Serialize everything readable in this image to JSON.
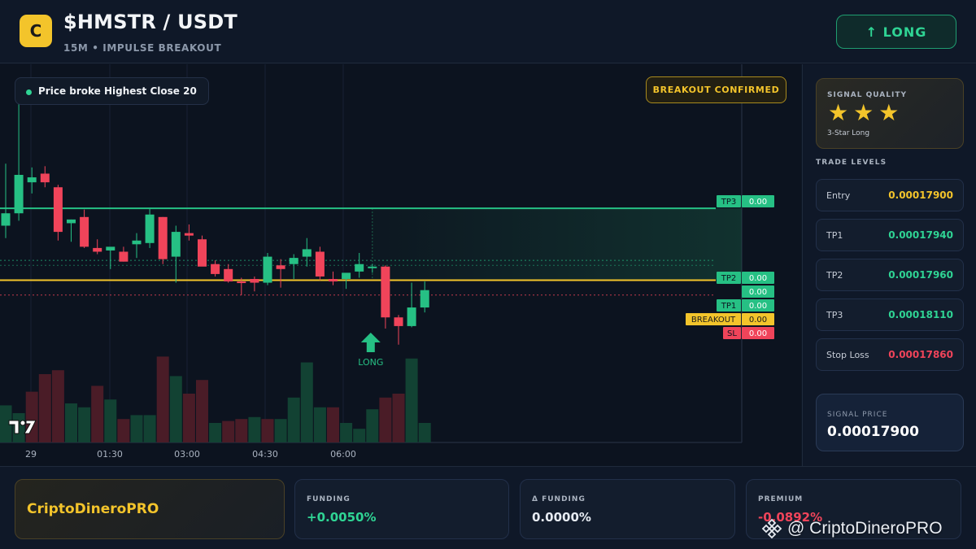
{
  "header": {
    "logo_letter": "C",
    "pair": "$HMSTR / USDT",
    "subtitle": "15M • IMPULSE BREAKOUT",
    "action_label": "↑ LONG"
  },
  "chart": {
    "note": "Price broke Highest Close 20",
    "badge": "BREAKOUT CONFIRMED",
    "signal_marker": "LONG",
    "time_labels": [
      "29",
      "01:30",
      "03:00",
      "04:30",
      "06:00"
    ],
    "level_tags": [
      {
        "label": "TP3",
        "value": "0.00"
      },
      {
        "label": "TP2",
        "value": "0.00"
      },
      {
        "label": "",
        "value": "0.00"
      },
      {
        "label": "TP1",
        "value": "0.00"
      },
      {
        "label": "BREAKOUT",
        "value": "0.00"
      },
      {
        "label": "SL",
        "value": "0.00"
      }
    ],
    "colors": {
      "up": "#26c084",
      "down": "#f0445a",
      "breakout": "#f3c42b"
    }
  },
  "chart_data": {
    "type": "candlestick",
    "x": [
      "29",
      "01:30",
      "03:00",
      "04:30",
      "06:00"
    ],
    "candles": [
      {
        "o": 0.00017946,
        "h": 0.00017996,
        "l": 0.00017936,
        "c": 0.00017956
      },
      {
        "o": 0.00017956,
        "h": 0.00018045,
        "l": 0.0001795,
        "c": 0.00017987
      },
      {
        "o": 0.00017981,
        "h": 0.00017993,
        "l": 0.00017972,
        "c": 0.00017985
      },
      {
        "o": 0.00017988,
        "h": 0.00017994,
        "l": 0.00017977,
        "c": 0.00017981
      },
      {
        "o": 0.00017977,
        "h": 0.00017979,
        "l": 0.00017934,
        "c": 0.00017941
      },
      {
        "o": 0.00017948,
        "h": 0.00017951,
        "l": 0.00017933,
        "c": 0.00017951
      },
      {
        "o": 0.00017953,
        "h": 0.00017959,
        "l": 0.00017928,
        "c": 0.00017929
      },
      {
        "o": 0.00017928,
        "h": 0.00017935,
        "l": 0.00017923,
        "c": 0.00017925
      },
      {
        "o": 0.00017926,
        "h": 0.00017928,
        "l": 0.00017911,
        "c": 0.00017929
      },
      {
        "o": 0.00017925,
        "h": 0.00017929,
        "l": 0.00017917,
        "c": 0.00017917
      },
      {
        "o": 0.00017931,
        "h": 0.0001794,
        "l": 0.0001792,
        "c": 0.00017934
      },
      {
        "o": 0.00017932,
        "h": 0.0001796,
        "l": 0.00017928,
        "c": 0.00017955
      },
      {
        "o": 0.00017953,
        "h": 0.00017953,
        "l": 0.00017915,
        "c": 0.00017919
      },
      {
        "o": 0.00017921,
        "h": 0.00017946,
        "l": 0.000179,
        "c": 0.00017941
      },
      {
        "o": 0.0001794,
        "h": 0.00017947,
        "l": 0.00017934,
        "c": 0.00017938
      },
      {
        "o": 0.00017935,
        "h": 0.00017938,
        "l": 0.00017914,
        "c": 0.00017913
      },
      {
        "o": 0.00017915,
        "h": 0.00017918,
        "l": 0.00017905,
        "c": 0.00017907
      },
      {
        "o": 0.00017911,
        "h": 0.00017915,
        "l": 0.000179,
        "c": 0.00017901
      },
      {
        "o": 0.00017901,
        "h": 0.00017904,
        "l": 0.0001789,
        "c": 0.000179
      },
      {
        "o": 0.00017903,
        "h": 0.00017905,
        "l": 0.00017893,
        "c": 0.000179
      },
      {
        "o": 0.000179,
        "h": 0.00017924,
        "l": 0.00017898,
        "c": 0.00017921
      },
      {
        "o": 0.00017914,
        "h": 0.00017919,
        "l": 0.00017896,
        "c": 0.00017911
      },
      {
        "o": 0.00017915,
        "h": 0.00017923,
        "l": 0.00017903,
        "c": 0.0001792
      },
      {
        "o": 0.00017921,
        "h": 0.00017936,
        "l": 0.00017913,
        "c": 0.00017927
      },
      {
        "o": 0.00017925,
        "h": 0.00017929,
        "l": 0.00017902,
        "c": 0.00017905
      },
      {
        "o": 0.00017903,
        "h": 0.00017909,
        "l": 0.00017898,
        "c": 0.00017901
      },
      {
        "o": 0.00017903,
        "h": 0.00017905,
        "l": 0.00017895,
        "c": 0.00017908
      },
      {
        "o": 0.00017909,
        "h": 0.00017924,
        "l": 0.00017904,
        "c": 0.00017915
      },
      {
        "o": 0.00017912,
        "h": 0.00017915,
        "l": 0.00017908,
        "c": 0.00017913
      },
      {
        "o": 0.00017913,
        "h": 0.00017914,
        "l": 0.00017863,
        "c": 0.00017872
      },
      {
        "o": 0.00017872,
        "h": 0.00017874,
        "l": 0.0001785,
        "c": 0.00017865
      },
      {
        "o": 0.00017865,
        "h": 0.000179,
        "l": 0.00017864,
        "c": 0.0001788
      },
      {
        "o": 0.0001788,
        "h": 0.00017901,
        "l": 0.00017876,
        "c": 0.00017894
      }
    ],
    "volume": [
      0.19,
      0.15,
      0.26,
      0.35,
      0.37,
      0.2,
      0.18,
      0.29,
      0.22,
      0.12,
      0.14,
      0.14,
      0.44,
      0.34,
      0.25,
      0.32,
      0.1,
      0.11,
      0.12,
      0.13,
      0.12,
      0.12,
      0.23,
      0.41,
      0.18,
      0.18,
      0.1,
      0.07,
      0.17,
      0.23,
      0.25,
      0.43,
      0.1
    ],
    "volume_up": [
      true,
      true,
      false,
      false,
      false,
      true,
      true,
      false,
      true,
      false,
      true,
      true,
      false,
      true,
      false,
      false,
      true,
      false,
      false,
      true,
      false,
      true,
      true,
      true,
      true,
      false,
      true,
      true,
      true,
      false,
      false,
      true,
      true
    ],
    "levels": {
      "tp3": 0.0001796,
      "tp2": 0.00017918,
      "mid": 0.00017914,
      "tp1": 0.00017904,
      "breakout": 0.00017902,
      "sl": 0.0001789
    }
  },
  "signal_quality": {
    "label": "SIGNAL QUALITY",
    "stars": 3,
    "star_glyph": "★",
    "description": "3-Star Long"
  },
  "trade_levels": {
    "title": "TRADE LEVELS",
    "rows": [
      {
        "label": "Entry",
        "value": "0.00017900",
        "color": "#f3c42b"
      },
      {
        "label": "TP1",
        "value": "0.00017940",
        "color": "#2fd494"
      },
      {
        "label": "TP2",
        "value": "0.00017960",
        "color": "#2fd494"
      },
      {
        "label": "TP3",
        "value": "0.00018110",
        "color": "#2fd494"
      },
      {
        "label": "Stop Loss",
        "value": "0.00017860",
        "color": "#f0445a"
      }
    ]
  },
  "signal_price": {
    "label": "SIGNAL PRICE",
    "value": "0.00017900"
  },
  "footer": {
    "brand": "CriptoDineroPRO",
    "stats": [
      {
        "label": "FUNDING",
        "value": "+0.0050%",
        "color": "#2fd494"
      },
      {
        "label": "Δ FUNDING",
        "value": "0.0000%",
        "color": "#e6ebf2"
      },
      {
        "label": "PREMIUM",
        "value": "-0.0892%",
        "color": "#f0445a"
      }
    ],
    "watermark": "@ CriptoDineroPRO"
  }
}
